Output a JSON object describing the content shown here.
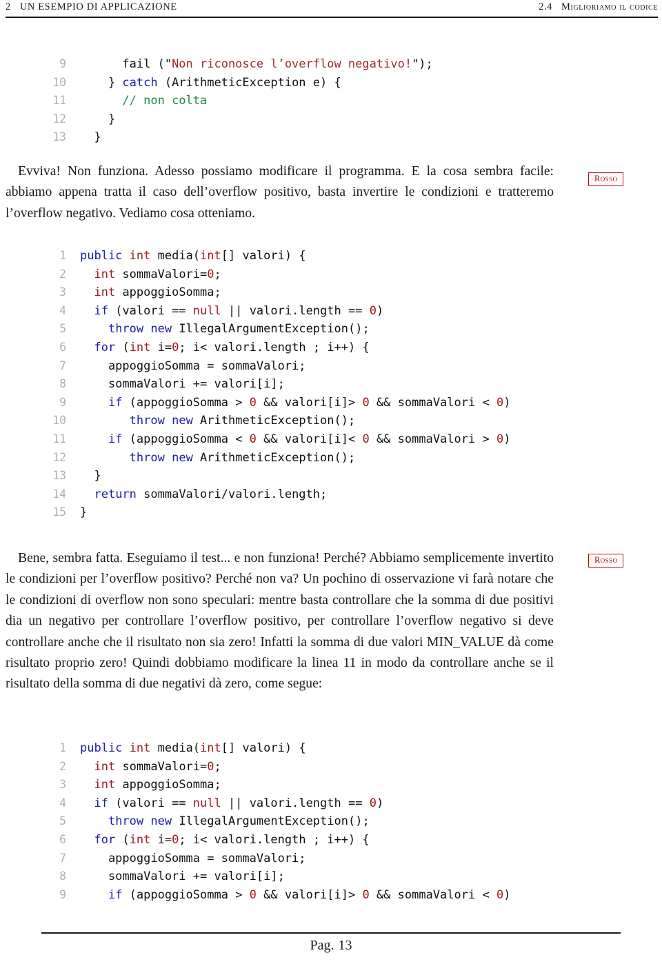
{
  "header": {
    "chapter_number": "2",
    "chapter_title": "UN ESEMPIO DI APPLICAZIONE",
    "section_number": "2.4",
    "section_title": "Miglioriamo il codice"
  },
  "footer": {
    "label": "Pag.",
    "page_number": "13"
  },
  "margin_notes": {
    "note_1": "Rosso",
    "note_2": "Rosso"
  },
  "paragraphs": {
    "para_1": "Evviva! Non funziona. Adesso possiamo modificare il programma. E la cosa sembra facile: abbiamo appena tratta il caso dell’overflow positivo, basta invertire le condizioni e tratteremo l’overflow negativo. Vediamo cosa otteniamo.",
    "para_2": "Bene, sembra fatta. Eseguiamo il test... e non funziona! Perché? Abbiamo semplicemente invertito le condizioni per l’overflow positivo? Perché non va? Un pochino di osservazione vi farà notare che le condizioni di overflow non sono speculari: mentre basta controllare che la somma di due positivi dia un negativo per controllare l’overflow positivo, per controllare l’overflow negativo si deve controllare anche che il risultato non sia zero! Infatti la somma di due valori MIN_VALUE dà come risultato proprio zero! Quindi dobbiamo modificare la linea 11 in modo da controllare anche se il risultato della somma di due negativi dà zero, come segue:"
  },
  "listings": {
    "listing_1": {
      "lines": [
        {
          "n": "9",
          "text": "      fail (\"Non riconosce l’overflow negativo!\");"
        },
        {
          "n": "10",
          "text": "    } catch (ArithmeticException e) {"
        },
        {
          "n": "11",
          "text": "      // non colta"
        },
        {
          "n": "12",
          "text": "    }"
        },
        {
          "n": "13",
          "text": "  }"
        }
      ]
    },
    "listing_2": {
      "lines": [
        {
          "n": "1",
          "text": "public int media(int[] valori) {"
        },
        {
          "n": "2",
          "text": "  int sommaValori=0;"
        },
        {
          "n": "3",
          "text": "  int appoggioSomma;"
        },
        {
          "n": "4",
          "text": "  if (valori == null || valori.length == 0)"
        },
        {
          "n": "5",
          "text": "    throw new IllegalArgumentException();"
        },
        {
          "n": "6",
          "text": "  for (int i=0; i< valori.length ; i++) {"
        },
        {
          "n": "7",
          "text": "    appoggioSomma = sommaValori;"
        },
        {
          "n": "8",
          "text": "    sommaValori += valori[i];"
        },
        {
          "n": "9",
          "text": "    if (appoggioSomma > 0 && valori[i]> 0 && sommaValori < 0)"
        },
        {
          "n": "10",
          "text": "       throw new ArithmeticException();"
        },
        {
          "n": "11",
          "text": "    if (appoggioSomma < 0 && valori[i]< 0 && sommaValori > 0)"
        },
        {
          "n": "12",
          "text": "       throw new ArithmeticException();"
        },
        {
          "n": "13",
          "text": "  }"
        },
        {
          "n": "14",
          "text": "  return sommaValori/valori.length;"
        },
        {
          "n": "15",
          "text": "}"
        }
      ]
    },
    "listing_3": {
      "lines": [
        {
          "n": "1",
          "text": "public int media(int[] valori) {"
        },
        {
          "n": "2",
          "text": "  int sommaValori=0;"
        },
        {
          "n": "3",
          "text": "  int appoggioSomma;"
        },
        {
          "n": "4",
          "text": "  if (valori == null || valori.length == 0)"
        },
        {
          "n": "5",
          "text": "    throw new IllegalArgumentException();"
        },
        {
          "n": "6",
          "text": "  for (int i=0; i< valori.length ; i++) {"
        },
        {
          "n": "7",
          "text": "    appoggioSomma = sommaValori;"
        },
        {
          "n": "8",
          "text": "    sommaValori += valori[i];"
        },
        {
          "n": "9",
          "text": "    if (appoggioSomma > 0 && valori[i]> 0 && sommaValori < 0)"
        }
      ]
    }
  },
  "colors": {
    "keyword": "#1a1aae",
    "type_literal": "#a01a1a",
    "string": "#a02c2c",
    "comment": "#1f8a3c",
    "line_number": "#b0b0b0",
    "margin_note_border": "#cc0000",
    "margin_note_text": "#b00000"
  }
}
